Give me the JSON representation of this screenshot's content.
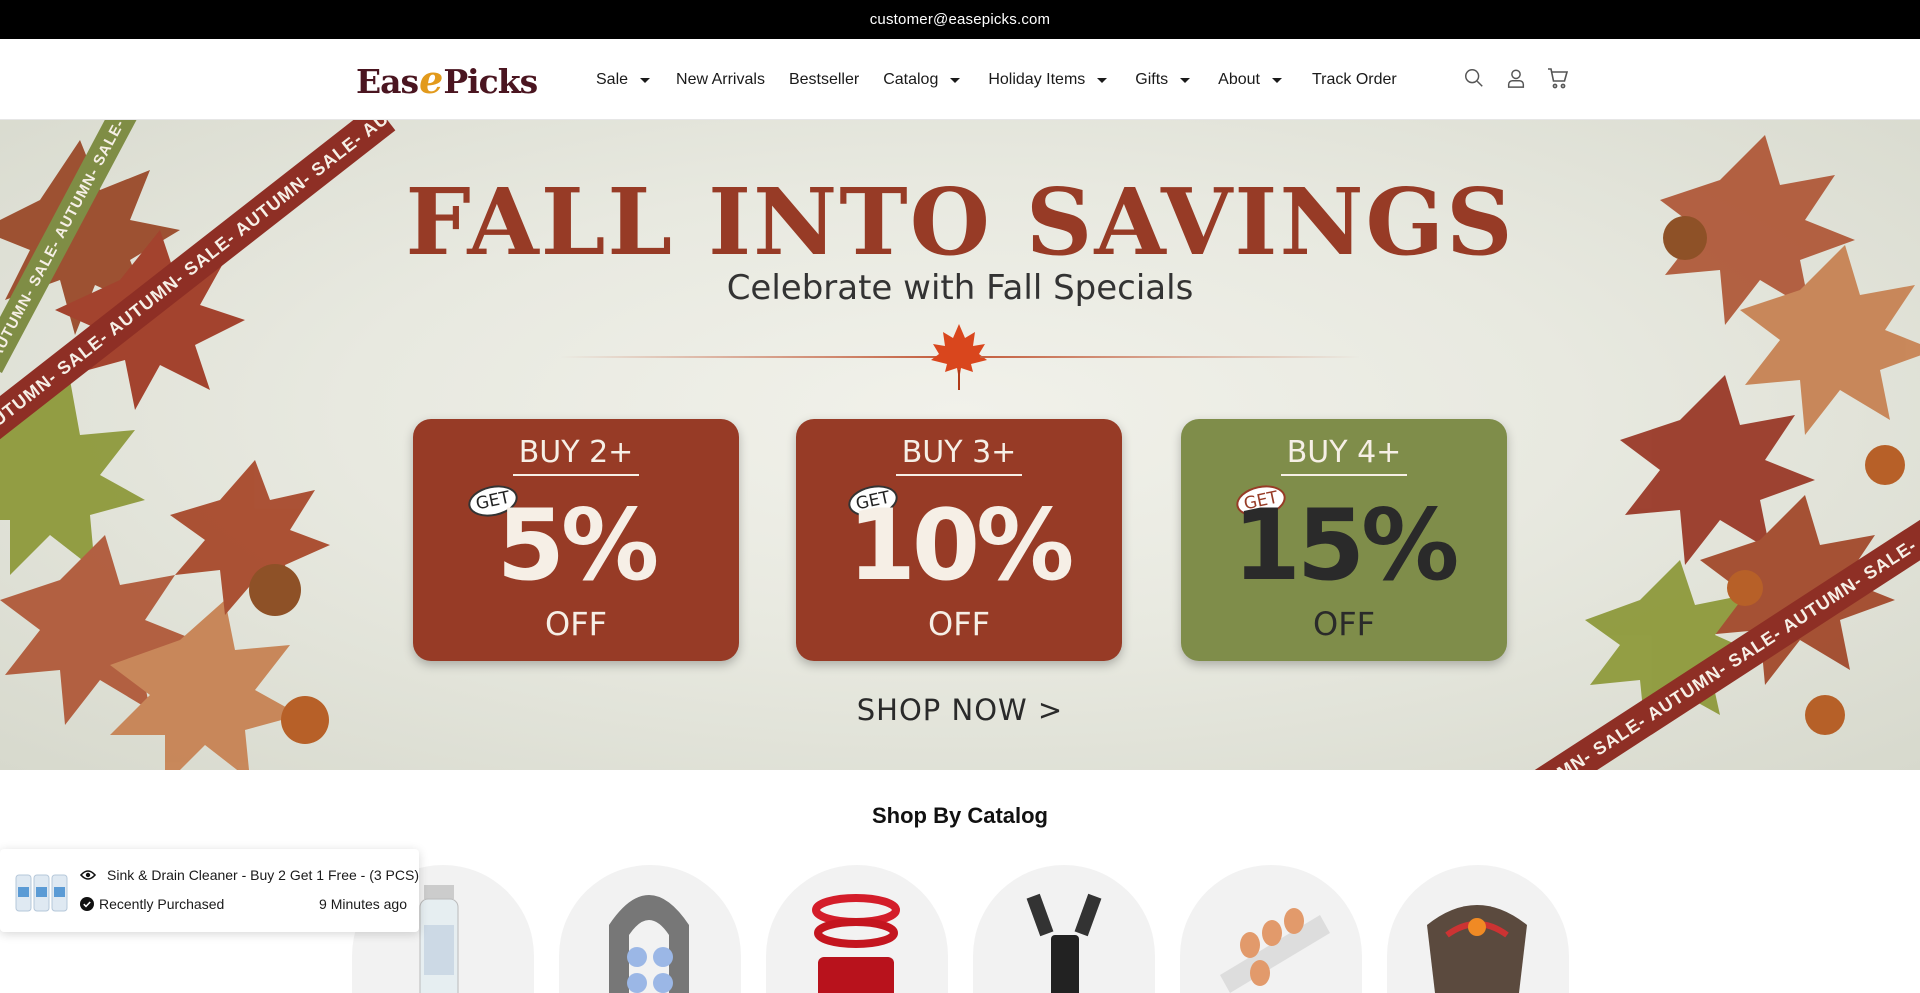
{
  "topbar": {
    "email": "customer@easepicks.com"
  },
  "header": {
    "logo": {
      "part1": "Eas",
      "part2": "e",
      "part3": "Picks"
    },
    "nav": [
      {
        "label": "Sale",
        "dropdown": true
      },
      {
        "label": "New Arrivals",
        "dropdown": false
      },
      {
        "label": "Bestseller",
        "dropdown": false
      },
      {
        "label": "Catalog",
        "dropdown": true
      },
      {
        "label": "Holiday Items",
        "dropdown": true
      },
      {
        "label": "Gifts",
        "dropdown": true
      },
      {
        "label": "About",
        "dropdown": true
      },
      {
        "label": "Track Order",
        "dropdown": false
      }
    ],
    "icons": [
      "search-icon",
      "account-icon",
      "cart-icon"
    ]
  },
  "hero": {
    "title": "FALL INTO SAVINGS",
    "subtitle": "Celebrate with Fall Specials",
    "ribbon_text": "AUTUMN- SALE- AUTUMN- SALE- AUTUMN- SALE- AUTUMN- SALE- AUTUMN- SALE-",
    "offers": [
      {
        "buy": "BUY 2+",
        "get": "GET",
        "percent": "5%",
        "off": "OFF",
        "bg": "#973b26",
        "fg": "#f6efe6"
      },
      {
        "buy": "BUY 3+",
        "get": "GET",
        "percent": "10%",
        "off": "OFF",
        "bg": "#973b26",
        "fg": "#f6efe6"
      },
      {
        "buy": "BUY 4+",
        "get": "GET",
        "percent": "15%",
        "off": "OFF",
        "bg": "#7f8d4a",
        "fg": "#2a2a2a"
      }
    ],
    "cta": "SHOP NOW >"
  },
  "catalog": {
    "title": "Shop By Catalog",
    "items": [
      "bottle",
      "massager",
      "car-ornament",
      "usb-adapter",
      "egg-dispenser",
      "pet-harness"
    ]
  },
  "toast": {
    "product": "Sink & Drain Cleaner - Buy 2 Get 1 Free - (3 PCS)",
    "status": "Recently Purchased",
    "time": "9 Minutes ago"
  },
  "colors": {
    "brand": "#4a1520",
    "accent": "#e29a1c",
    "rust": "#973b26",
    "olive": "#7f8d4a"
  }
}
